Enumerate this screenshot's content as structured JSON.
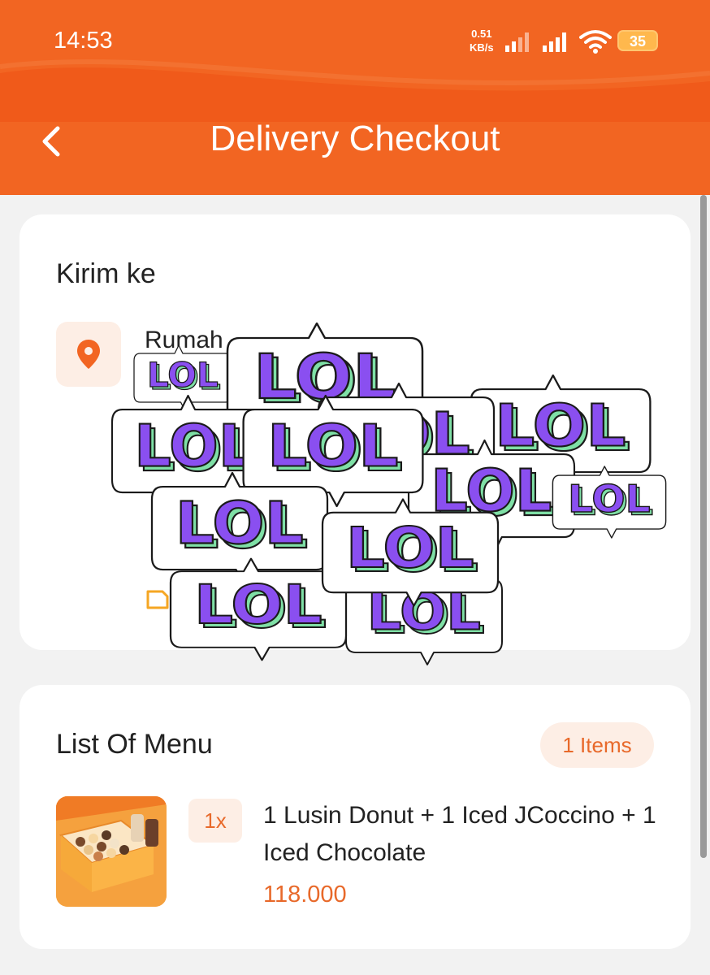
{
  "status_bar": {
    "time": "14:53",
    "net_speed_value": "0.51",
    "net_speed_unit": "KB/s",
    "battery": "35"
  },
  "header": {
    "title": "Delivery Checkout",
    "back_icon": "chevron-left-icon"
  },
  "address_card": {
    "title": "Kirim ke",
    "location_icon": "map-pin-icon",
    "address_label": "Rumah",
    "note_icon": "note-icon"
  },
  "overlay": {
    "sticker_text": "LOL"
  },
  "menu_card": {
    "title": "List Of Menu",
    "items_badge": "1 Items",
    "items": [
      {
        "quantity": "1x",
        "name": "1 Lusin Donut + 1 Iced JCoccino + 1 Iced Chocolate",
        "price": "118.000"
      }
    ]
  },
  "colors": {
    "accent": "#f26522",
    "accent_text": "#e8692a",
    "accent_soft": "#fdeee5",
    "sticker_purple": "#8a4ff0",
    "sticker_green": "#7fe0a6"
  }
}
